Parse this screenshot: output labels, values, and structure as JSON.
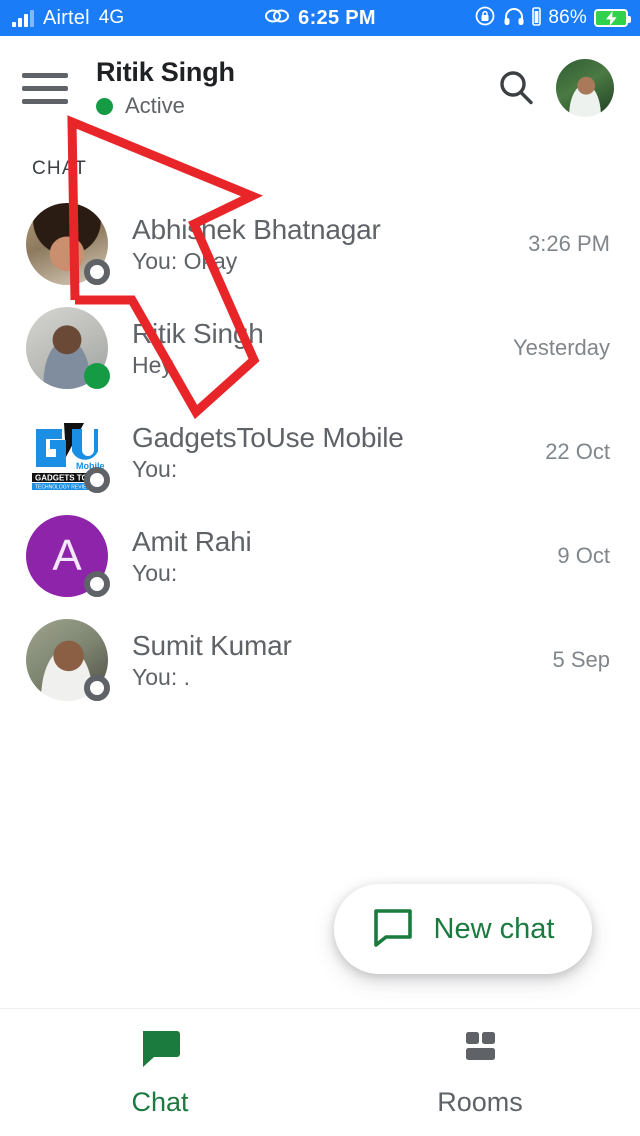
{
  "status_bar": {
    "carrier": "Airtel",
    "network": "4G",
    "time": "6:25 PM",
    "battery_percent": "86%",
    "background_color": "#1a7cf7",
    "battery_color": "#2fd24a",
    "icons": [
      "signal-bars-icon",
      "link-icon",
      "rotation-lock-icon",
      "headphones-icon",
      "battery-charging-icon"
    ]
  },
  "header": {
    "title": "Ritik Singh",
    "presence": "Active",
    "presence_color": "#169b45",
    "menu_icon": "hamburger-menu-icon",
    "search_icon": "search-icon",
    "avatar": "profile-avatar"
  },
  "section": {
    "label": "CHAT"
  },
  "chats": [
    {
      "name": "Abhishek Bhatnagar",
      "snippet": "You: Okay",
      "time": "3:26 PM",
      "presence": "offline",
      "avatar_type": "photo",
      "avatar_class": "ph-abhishek"
    },
    {
      "name": "Ritik Singh",
      "snippet": "Hey",
      "time": "Yesterday",
      "presence": "online",
      "avatar_type": "photo",
      "avatar_class": "ph-ritik"
    },
    {
      "name": "GadgetsToUse Mobile",
      "snippet": "You:",
      "time": "22 Oct",
      "presence": "offline",
      "avatar_type": "logo",
      "avatar_class": "ph-gtu",
      "logo_text": "GU",
      "logo_sub": "GADGETS TO USE",
      "logo_color": "#1a8fe3"
    },
    {
      "name": "Amit Rahi",
      "snippet": "You:",
      "time": "9 Oct",
      "presence": "offline",
      "avatar_type": "initial",
      "initial": "A",
      "avatar_color": "#8e24aa"
    },
    {
      "name": "Sumit Kumar",
      "snippet": "You: .",
      "time": "5 Sep",
      "presence": "offline",
      "avatar_type": "photo",
      "avatar_class": "ph-sumit"
    }
  ],
  "fab": {
    "label": "New chat",
    "icon": "chat-bubble-outline-icon",
    "color": "#1b7a3e"
  },
  "bottom_nav": {
    "items": [
      {
        "label": "Chat",
        "icon": "chat-bubble-filled-icon",
        "active": true
      },
      {
        "label": "Rooms",
        "icon": "rooms-grid-icon",
        "active": false
      }
    ],
    "active_color": "#1b7a3e",
    "inactive_color": "#5f6368"
  },
  "annotation": {
    "type": "arrow",
    "color": "#e8262a",
    "points_to": "hamburger-menu-icon"
  }
}
